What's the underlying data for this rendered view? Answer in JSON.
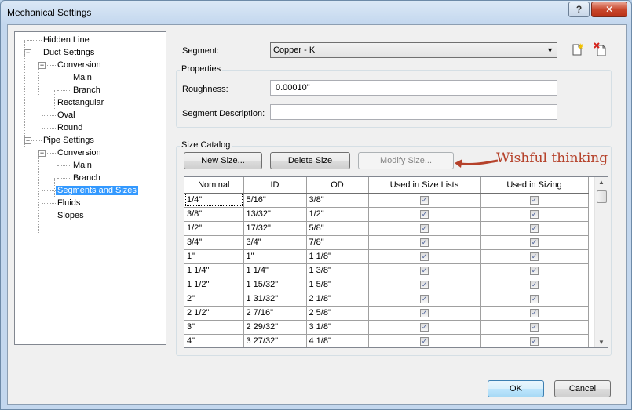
{
  "window": {
    "title": "Mechanical Settings",
    "help_label": "?",
    "close_label": "✕"
  },
  "tree": [
    {
      "label": "Hidden Line",
      "level": 0,
      "expander": ""
    },
    {
      "label": "Duct Settings",
      "level": 0,
      "expander": "−"
    },
    {
      "label": "Conversion",
      "level": 1,
      "expander": "−"
    },
    {
      "label": "Main",
      "level": 2,
      "expander": ""
    },
    {
      "label": "Branch",
      "level": 2,
      "expander": ""
    },
    {
      "label": "Rectangular",
      "level": 1,
      "expander": ""
    },
    {
      "label": "Oval",
      "level": 1,
      "expander": ""
    },
    {
      "label": "Round",
      "level": 1,
      "expander": ""
    },
    {
      "label": "Pipe Settings",
      "level": 0,
      "expander": "−"
    },
    {
      "label": "Conversion",
      "level": 1,
      "expander": "−"
    },
    {
      "label": "Main",
      "level": 2,
      "expander": ""
    },
    {
      "label": "Branch",
      "level": 2,
      "expander": ""
    },
    {
      "label": "Segments and Sizes",
      "level": 1,
      "expander": "",
      "selected": true
    },
    {
      "label": "Fluids",
      "level": 1,
      "expander": ""
    },
    {
      "label": "Slopes",
      "level": 1,
      "expander": ""
    }
  ],
  "segment": {
    "label": "Segment:",
    "value": "Copper - K"
  },
  "icons": {
    "new_segment": "new-segment-icon",
    "delete_segment": "delete-segment-icon"
  },
  "properties": {
    "title": "Properties",
    "roughness_label": "Roughness:",
    "roughness_value": "0.00010\"",
    "description_label": "Segment Description:",
    "description_value": ""
  },
  "size_catalog": {
    "title": "Size Catalog",
    "new_size": "New Size...",
    "delete_size": "Delete Size",
    "modify_size": "Modify Size..."
  },
  "annotation": "Wishful thinking",
  "accent_color": "#b5412a",
  "table": {
    "columns": [
      "Nominal",
      "ID",
      "OD",
      "Used in Size Lists",
      "Used in Sizing"
    ],
    "rows": [
      [
        "1/4\"",
        "5/16\"",
        "3/8\"",
        true,
        true
      ],
      [
        "3/8\"",
        "13/32\"",
        "1/2\"",
        true,
        true
      ],
      [
        "1/2\"",
        "17/32\"",
        "5/8\"",
        true,
        true
      ],
      [
        "3/4\"",
        "3/4\"",
        "7/8\"",
        true,
        true
      ],
      [
        "1\"",
        "1\"",
        "1 1/8\"",
        true,
        true
      ],
      [
        "1 1/4\"",
        "1 1/4\"",
        "1 3/8\"",
        true,
        true
      ],
      [
        "1 1/2\"",
        "1 15/32\"",
        "1 5/8\"",
        true,
        true
      ],
      [
        "2\"",
        "1 31/32\"",
        "2 1/8\"",
        true,
        true
      ],
      [
        "2 1/2\"",
        "2 7/16\"",
        "2 5/8\"",
        true,
        true
      ],
      [
        "3\"",
        "2 29/32\"",
        "3 1/8\"",
        true,
        true
      ],
      [
        "4\"",
        "3 27/32\"",
        "4 1/8\"",
        true,
        true
      ]
    ]
  },
  "footer": {
    "ok": "OK",
    "cancel": "Cancel"
  }
}
